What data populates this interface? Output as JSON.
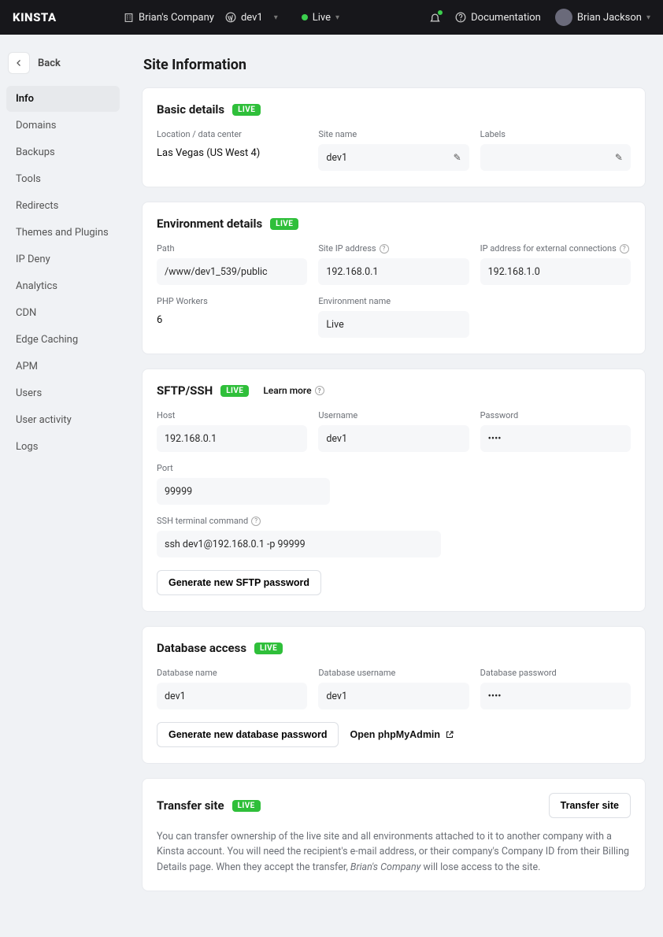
{
  "topbar": {
    "logo": "KINSTA",
    "company": "Brian's Company",
    "site": "dev1",
    "env_label": "Live",
    "documentation": "Documentation",
    "user_name": "Brian Jackson"
  },
  "sidebar": {
    "back_label": "Back",
    "items": [
      {
        "label": "Info",
        "slug": "info",
        "active": true
      },
      {
        "label": "Domains",
        "slug": "domains"
      },
      {
        "label": "Backups",
        "slug": "backups"
      },
      {
        "label": "Tools",
        "slug": "tools"
      },
      {
        "label": "Redirects",
        "slug": "redirects"
      },
      {
        "label": "Themes and Plugins",
        "slug": "themes-and-plugins"
      },
      {
        "label": "IP Deny",
        "slug": "ip-deny"
      },
      {
        "label": "Analytics",
        "slug": "analytics"
      },
      {
        "label": "CDN",
        "slug": "cdn"
      },
      {
        "label": "Edge Caching",
        "slug": "edge-caching"
      },
      {
        "label": "APM",
        "slug": "apm"
      },
      {
        "label": "Users",
        "slug": "users"
      },
      {
        "label": "User activity",
        "slug": "user-activity"
      },
      {
        "label": "Logs",
        "slug": "logs"
      }
    ]
  },
  "page": {
    "title": "Site Information",
    "live_badge": "LIVE",
    "learn_more": "Learn more"
  },
  "basic": {
    "heading": "Basic details",
    "location_label": "Location / data center",
    "location_value": "Las Vegas (US West 4)",
    "sitename_label": "Site name",
    "sitename_value": "dev1",
    "labels_label": "Labels",
    "labels_value": ""
  },
  "env": {
    "heading": "Environment details",
    "path_label": "Path",
    "path_value": "/www/dev1_539/public",
    "siteip_label": "Site IP address",
    "siteip_value": "192.168.0.1",
    "extip_label": "IP address for external connections",
    "extip_value": "192.168.1.0",
    "workers_label": "PHP Workers",
    "workers_value": "6",
    "envname_label": "Environment name",
    "envname_value": "Live"
  },
  "sftp": {
    "heading": "SFTP/SSH",
    "host_label": "Host",
    "host_value": "192.168.0.1",
    "user_label": "Username",
    "user_value": "dev1",
    "pass_label": "Password",
    "pass_value": "••••",
    "port_label": "Port",
    "port_value": "99999",
    "ssh_label": "SSH terminal command",
    "ssh_value": "ssh dev1@192.168.0.1 -p 99999",
    "gen_button": "Generate new SFTP password"
  },
  "db": {
    "heading": "Database access",
    "name_label": "Database name",
    "name_value": "dev1",
    "user_label": "Database username",
    "user_value": "dev1",
    "pass_label": "Database password",
    "pass_value": "••••",
    "gen_button": "Generate new database password",
    "pma_button": "Open phpMyAdmin"
  },
  "transfer": {
    "heading": "Transfer site",
    "button": "Transfer site",
    "text_pre": "You can transfer ownership of the live site and all environments attached to it to another company with a Kinsta account. You will need the recipient's e-mail address, or their company's Company ID from their Billing Details page. When they accept the transfer, ",
    "text_em": "Brian's Company",
    "text_post": " will lose access to the site."
  }
}
